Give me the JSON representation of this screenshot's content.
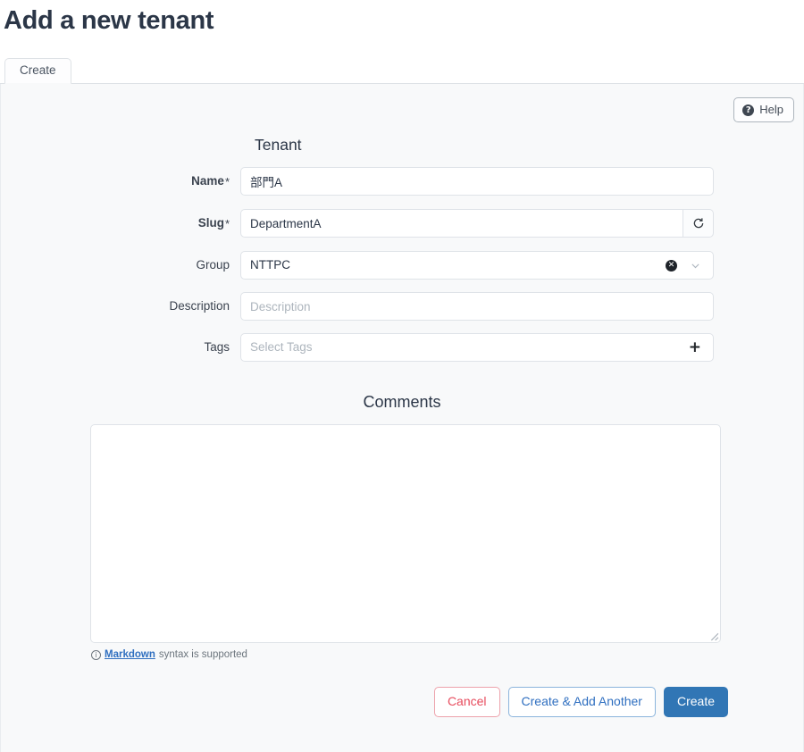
{
  "page": {
    "title": "Add a new tenant"
  },
  "tabs": [
    {
      "label": "Create",
      "name": "tab-create",
      "active": true
    }
  ],
  "toolbar": {
    "help_label": "Help",
    "help_icon": "question-circle-icon"
  },
  "sections": {
    "tenant": {
      "heading": "Tenant",
      "fields": {
        "name": {
          "label": "Name",
          "required_marker": "*",
          "value": "部門A",
          "placeholder": ""
        },
        "slug": {
          "label": "Slug",
          "required_marker": "*",
          "value": "DepartmentA",
          "placeholder": "",
          "regenerate_icon": "refresh-icon"
        },
        "group": {
          "label": "Group",
          "value": "NTTPC",
          "clear_icon": "clear-circle-icon",
          "chevron_icon": "chevron-down-icon"
        },
        "description": {
          "label": "Description",
          "value": "",
          "placeholder": "Description"
        },
        "tags": {
          "label": "Tags",
          "value": "",
          "placeholder": "Select Tags",
          "add_icon": "plus-icon"
        }
      }
    },
    "comments": {
      "heading": "Comments",
      "value": "",
      "placeholder": "",
      "help_icon": "info-circle-icon",
      "help_link_text": "Markdown",
      "help_text_suffix": "syntax is supported"
    }
  },
  "footer": {
    "cancel_label": "Cancel",
    "create_another_label": "Create & Add Another",
    "create_label": "Create"
  },
  "colors": {
    "primary": "#3176b5",
    "danger": "#e74c5e",
    "link": "#2f6fc0",
    "panel_bg": "#f8f9fa",
    "border": "#dfe3e8",
    "text": "#2b3647"
  }
}
